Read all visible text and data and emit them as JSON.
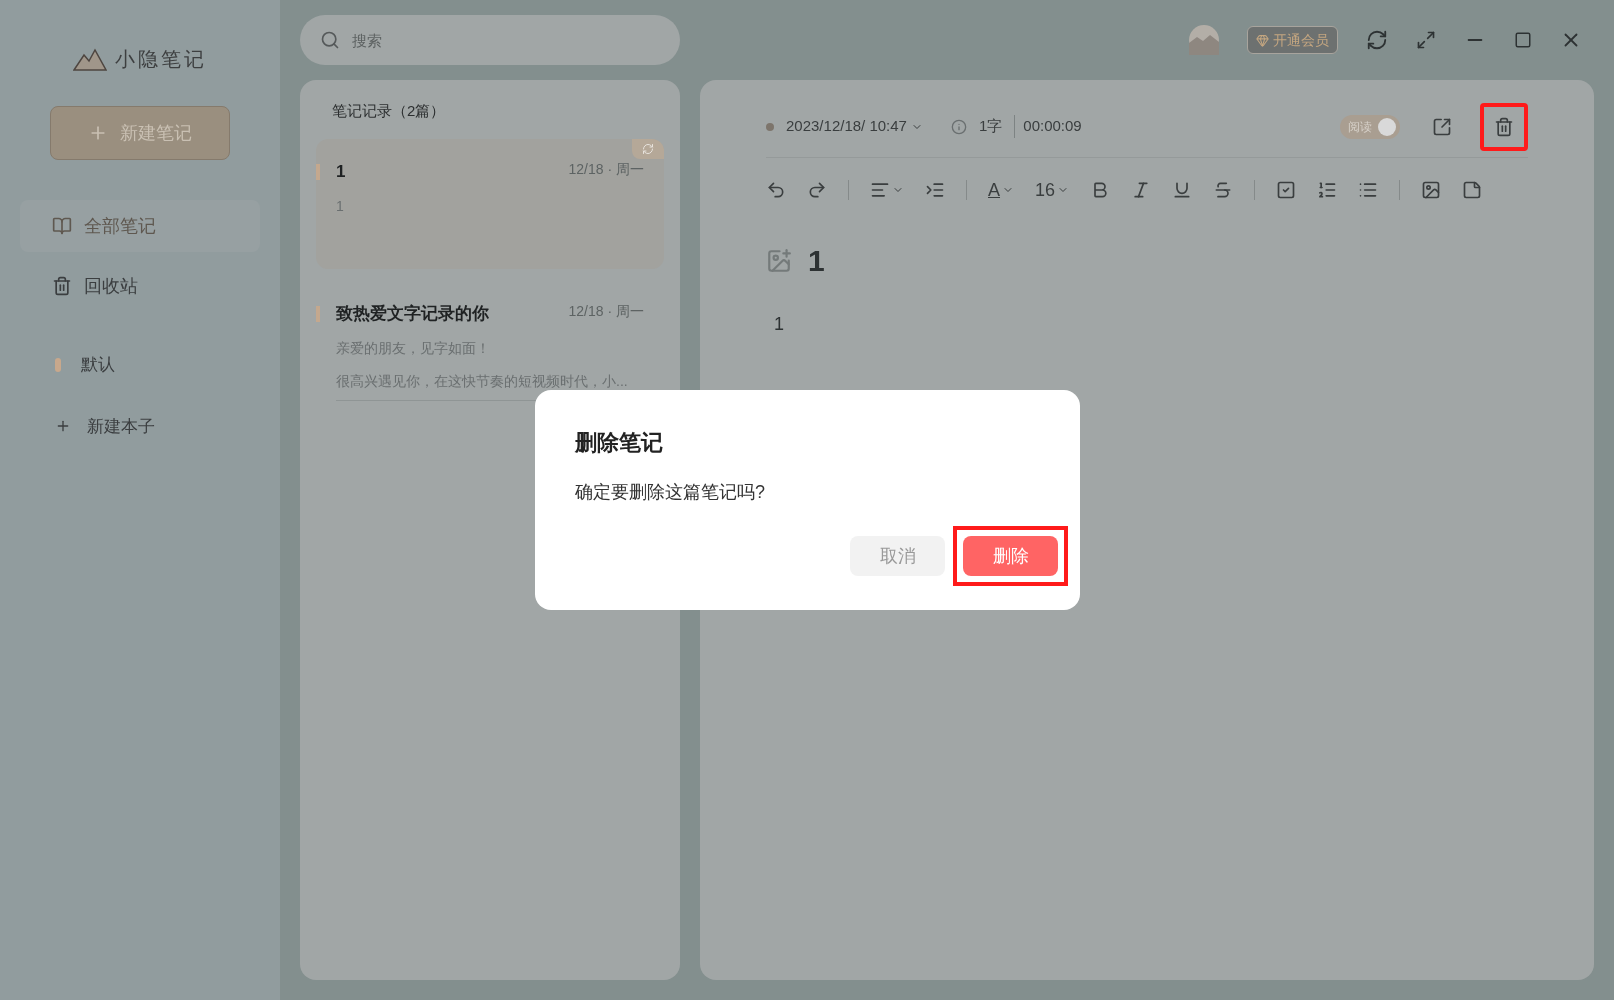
{
  "app_name": "小隐笔记",
  "sidebar": {
    "new_note": "新建笔记",
    "nav": [
      {
        "kind": "book",
        "label": "全部笔记",
        "selected": true
      },
      {
        "kind": "trash",
        "label": "回收站",
        "selected": false
      }
    ],
    "notebooks": [
      {
        "label": "默认",
        "color": "#c8a88c"
      }
    ],
    "add_notebook": "新建本子"
  },
  "search": {
    "placeholder": "搜索"
  },
  "top_bar": {
    "vip": "开通会员"
  },
  "note_list": {
    "title": "笔记记录（2篇）",
    "notes": [
      {
        "title": "1",
        "date": "12/18 · 周一",
        "preview": [
          "1"
        ],
        "selected": true,
        "synced": true
      },
      {
        "title": "致热爱文字记录的你",
        "date": "12/18 · 周一",
        "preview": [
          "亲爱的朋友，见字如面！",
          "很高兴遇见你，在这快节奏的短视频时代，小..."
        ],
        "selected": false,
        "synced": false
      }
    ]
  },
  "editor": {
    "datetime": "2023/12/18/ 10:47",
    "word_count": "1字",
    "duration": "00:00:09",
    "read_toggle": {
      "label": "阅读",
      "on": true
    },
    "text_color": "A",
    "font_size": "16",
    "title": "1",
    "body": "1"
  },
  "dialog": {
    "title": "删除笔记",
    "message": "确定要删除这篇笔记吗?",
    "cancel": "取消",
    "confirm": "删除"
  }
}
